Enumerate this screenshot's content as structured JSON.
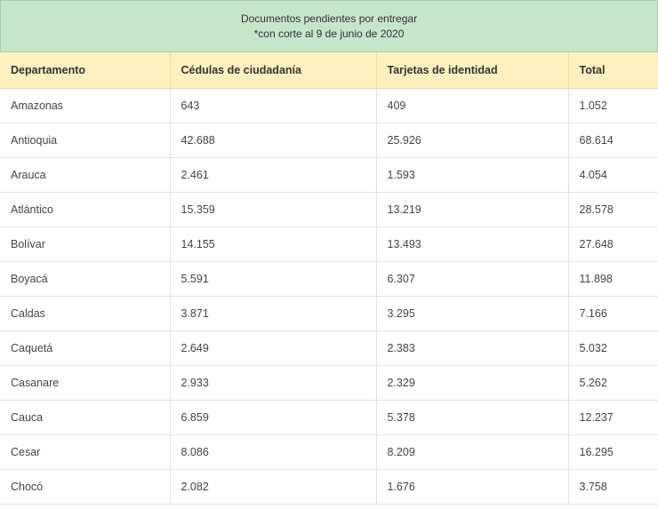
{
  "caption": {
    "line1": "Documentos pendientes por entregar",
    "line2": "*con corte al 9 de junio de 2020"
  },
  "headers": [
    "Departamento",
    "Cédulas de ciudadanía",
    "Tarjetas de identidad",
    "Total"
  ],
  "rows": [
    [
      "Amazonas",
      "643",
      "409",
      "1.052"
    ],
    [
      "Antioquia",
      "42.688",
      "25.926",
      "68.614"
    ],
    [
      "Arauca",
      "2.461",
      "1.593",
      "4.054"
    ],
    [
      "Atlántico",
      "15.359",
      "13.219",
      "28.578"
    ],
    [
      "Bolívar",
      "14.155",
      "13.493",
      "27.648"
    ],
    [
      "Boyacá",
      "5.591",
      "6.307",
      "11.898"
    ],
    [
      "Caldas",
      "3.871",
      "3.295",
      "7.166"
    ],
    [
      "Caquetá",
      "2.649",
      "2.383",
      "5.032"
    ],
    [
      "Casanare",
      "2.933",
      "2.329",
      "5.262"
    ],
    [
      "Cauca",
      "6.859",
      "5.378",
      "12.237"
    ],
    [
      "Cesar",
      "8.086",
      "8.209",
      "16.295"
    ],
    [
      "Chocó",
      "2.082",
      "1.676",
      "3.758"
    ]
  ]
}
